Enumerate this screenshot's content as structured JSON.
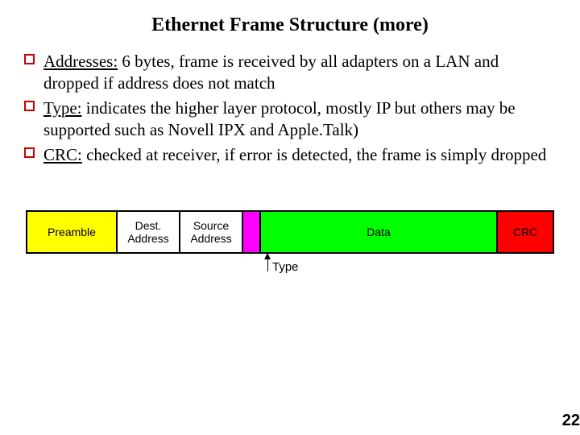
{
  "title": "Ethernet Frame Structure (more)",
  "bullets": [
    {
      "term": "Addresses:",
      "rest": " 6 bytes, frame is received by all adapters on a LAN and dropped if address does not match"
    },
    {
      "term": "Type:",
      "rest": " indicates the higher layer protocol, mostly IP but others may be supported such as Novell IPX and Apple.Talk)"
    },
    {
      "term": "CRC:",
      "rest": " checked at receiver, if error is detected, the frame is simply dropped"
    }
  ],
  "frame": {
    "preamble": "Preamble",
    "dest": "Dest.\nAddress",
    "source": "Source\nAddress",
    "data": "Data",
    "crc": "CRC"
  },
  "type_label": "Type",
  "page_number": "22"
}
